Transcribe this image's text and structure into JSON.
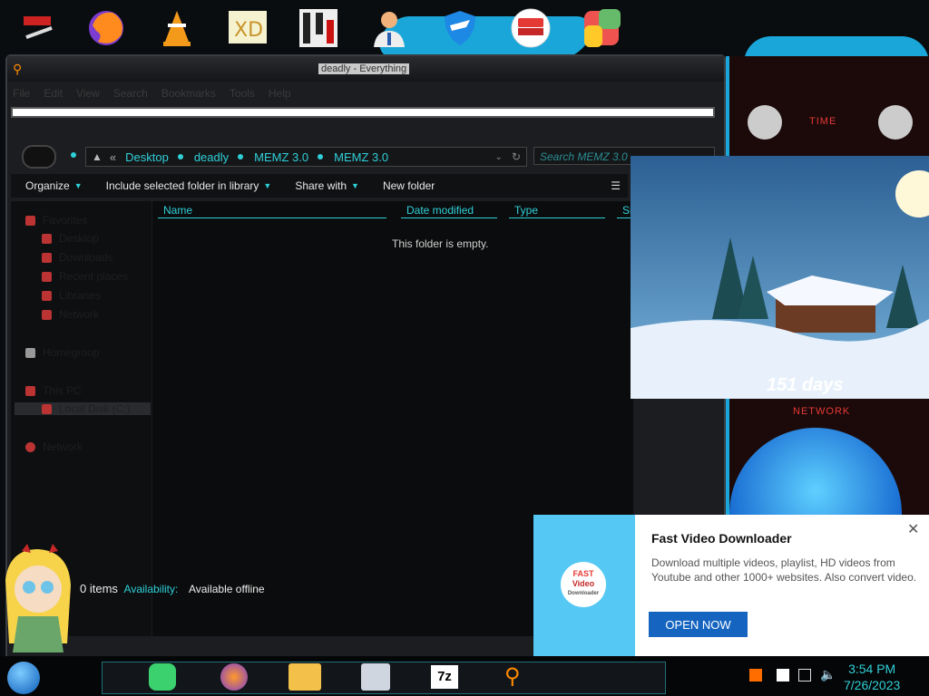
{
  "desktop": {
    "icons": [
      "tool-icon",
      "firefox-icon",
      "vlc-icon",
      "hxd-icon",
      "maze-app-icon",
      "user-doctor-icon",
      "shield-app-icon",
      "fast-video-downloader-icon",
      "puzzle-app-icon"
    ],
    "accent": "#1aa6d8"
  },
  "window": {
    "title": "deadly - Everything",
    "menu": [
      "File",
      "Edit",
      "View",
      "Search",
      "Bookmarks",
      "Tools",
      "Help"
    ],
    "address": {
      "overflow": "«",
      "crumbs": [
        "Desktop",
        "deadly",
        "MEMZ 3.0",
        "MEMZ 3.0"
      ]
    },
    "search_placeholder": "Search MEMZ 3.0",
    "toolbar": {
      "organize": "Organize",
      "include": "Include selected folder in library",
      "share": "Share with",
      "new_folder": "New folder"
    },
    "columns": [
      "Name",
      "Date modified",
      "Type",
      "Si"
    ],
    "empty_text": "This folder is empty.",
    "nav_items": [
      "Favorites",
      "Desktop",
      "Downloads",
      "Recent places",
      "Libraries",
      "Network",
      "Homegroup",
      "This PC",
      "Local Disk (C:)",
      "Network"
    ],
    "status": {
      "count": "0 items",
      "availability_label": "Availability:",
      "availability_value": "Available offline"
    }
  },
  "gadget": {
    "time_label": "TIME",
    "network_label": "NETWORK"
  },
  "countdown": {
    "text": "151 days"
  },
  "popup": {
    "title": "Fast Video Downloader",
    "body": "Download multiple videos, playlist, HD videos from Youtube and other 1000+ websites. Also convert video.",
    "button": "OPEN NOW",
    "logo_line1": "FAST",
    "logo_line2": "Video",
    "logo_line3": "Downloader"
  },
  "taskbar": {
    "apps": [
      "chat-app-icon",
      "firefox-icon",
      "file-explorer-icon",
      "monitor-app-icon",
      "7zip-icon",
      "search-app-icon"
    ],
    "seven_zip": "7z",
    "time": "3:54 PM",
    "date": "7/26/2023"
  }
}
